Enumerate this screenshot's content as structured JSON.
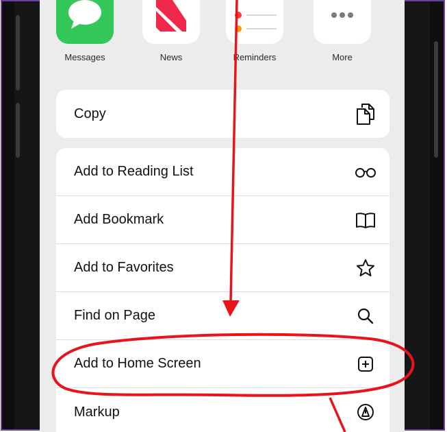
{
  "share_apps": [
    {
      "label": "Messages",
      "icon": "messages-icon"
    },
    {
      "label": "News",
      "icon": "news-icon"
    },
    {
      "label": "Reminders",
      "icon": "reminders-icon"
    },
    {
      "label": "More",
      "icon": "more-icon"
    }
  ],
  "actions": {
    "copy": {
      "label": "Copy",
      "icon": "copy-icon"
    },
    "reading_list": {
      "label": "Add to Reading List",
      "icon": "glasses-icon"
    },
    "bookmark": {
      "label": "Add Bookmark",
      "icon": "book-icon"
    },
    "favorites": {
      "label": "Add to Favorites",
      "icon": "star-icon"
    },
    "find": {
      "label": "Find on Page",
      "icon": "search-icon"
    },
    "home_screen": {
      "label": "Add to Home Screen",
      "icon": "plus-square-icon"
    },
    "markup": {
      "label": "Markup",
      "icon": "markup-icon"
    }
  },
  "colors": {
    "annotation": "#e8141c",
    "frame_border": "#6a3fa0",
    "sheet_background": "#ececec",
    "messages_green": "#34c759",
    "news_red": "#f0284a"
  }
}
